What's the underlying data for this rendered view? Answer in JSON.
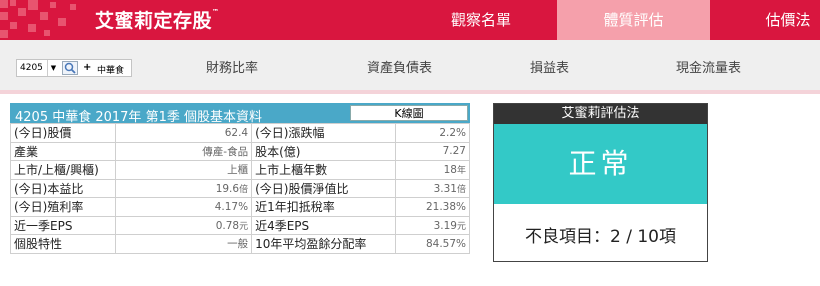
{
  "header": {
    "brand": "艾蜜莉定存股",
    "brand_mark": "™",
    "nav": {
      "watchlist": "觀察名單",
      "health": "體質評估",
      "valuation": "估價法"
    },
    "colors": {
      "primary": "#d9163f",
      "active_tab": "#f5a0ab"
    }
  },
  "subnav": {
    "stock_code": "4205",
    "stock_name": "中華食",
    "dropdown_icon": "chevron-down-icon",
    "search_icon": "search-icon",
    "add_icon": "plus-icon",
    "tabs": [
      "財務比率",
      "資產負債表",
      "損益表",
      "現金流量表"
    ]
  },
  "basic_info": {
    "title": "4205  中華食  2017年 第1季 個股基本資料",
    "kline_button": "K線圖",
    "rows": [
      {
        "l1": "(今日)股價",
        "v1": "62.4",
        "u1": "",
        "l2": "(今日)漲跌幅",
        "v2": "2.2%",
        "u2": ""
      },
      {
        "l1": "產業",
        "v1": "傳產-食品",
        "u1": "",
        "l2": "股本(億)",
        "v2": "7.27",
        "u2": ""
      },
      {
        "l1": "上市/上櫃/興櫃)",
        "v1": "上櫃",
        "u1": "",
        "l2": "上市上櫃年數",
        "v2": "18",
        "u2": "年"
      },
      {
        "l1": "(今日)本益比",
        "v1": "19.6",
        "u1": "倍",
        "l2": "(今日)股價淨值比",
        "v2": "3.31",
        "u2": "倍"
      },
      {
        "l1": "(今日)殖利率",
        "v1": "4.17%",
        "u1": "",
        "l2": "近1年扣抵稅率",
        "v2": "21.38%",
        "u2": ""
      },
      {
        "l1": "近一季EPS",
        "v1": "0.78",
        "u1": "元",
        "l2": "近4季EPS",
        "v2": "3.19",
        "u2": "元"
      },
      {
        "l1": "個股特性",
        "v1": "一般",
        "u1": "",
        "l2": "10年平均盈餘分配率",
        "v2": "84.57%",
        "u2": ""
      }
    ]
  },
  "evaluation": {
    "title": "艾蜜莉評估法",
    "status": "正常",
    "bad_items": "不良項目：2 / 10項",
    "status_color": "#33c9c7"
  }
}
